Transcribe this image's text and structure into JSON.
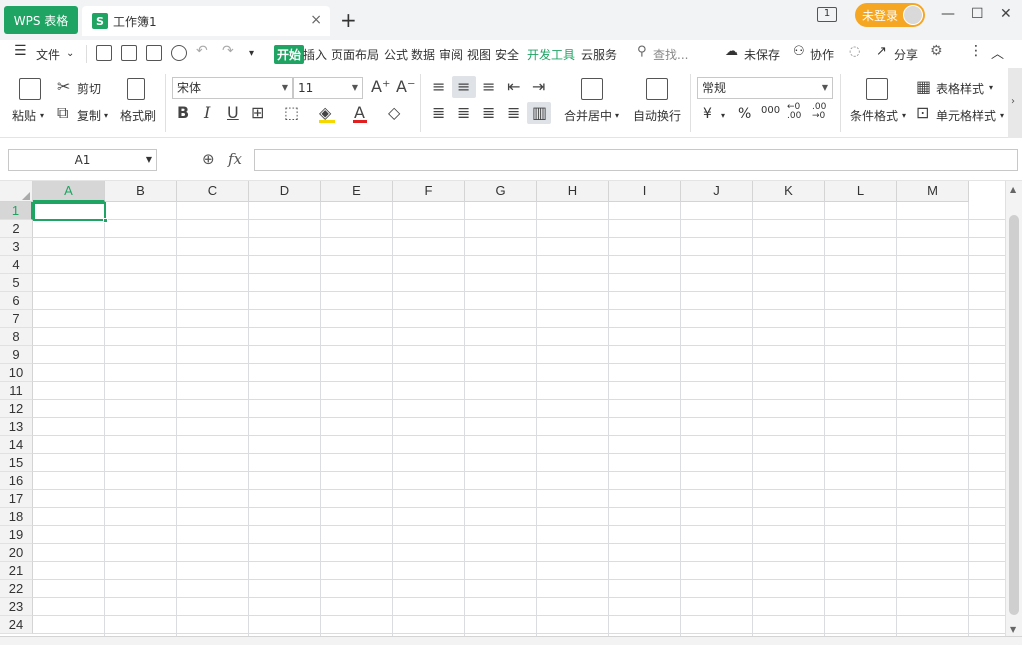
{
  "titlebar": {
    "app_tab": "WPS 表格",
    "doc_tab": "工作簿1",
    "doc_icon": "S",
    "close": "×",
    "add": "+",
    "login": "未登录",
    "badge": "1",
    "minimize": "—",
    "maximize": "☐",
    "close_window": "✕"
  },
  "menu": {
    "file": "文件",
    "tabs": [
      "开始",
      "插入",
      "页面布局",
      "公式",
      "数据",
      "审阅",
      "视图",
      "安全",
      "开发工具",
      "云服务"
    ],
    "search": "查找...",
    "unsaved": "未保存",
    "collab": "协作",
    "share": "分享"
  },
  "ribbon": {
    "paste": "粘贴",
    "cut": "剪切",
    "copy": "复制",
    "format_painter": "格式刷",
    "font_name": "宋体",
    "font_size": "11",
    "merge_center": "合并居中",
    "wrap_text": "自动换行",
    "number_format": "常规",
    "currency": "¥",
    "percent": "%",
    "thousands": "000",
    "cond_format": "条件格式",
    "table_style": "表格样式",
    "cell_style": "单元格样式"
  },
  "formula_bar": {
    "cell_ref": "A1",
    "fx": "fx",
    "value": ""
  },
  "grid": {
    "columns": [
      "A",
      "B",
      "C",
      "D",
      "E",
      "F",
      "G",
      "H",
      "I",
      "J",
      "K",
      "L",
      "M"
    ],
    "rows": [
      "1",
      "2",
      "3",
      "4",
      "5",
      "6",
      "7",
      "8",
      "9",
      "10",
      "11",
      "12",
      "13",
      "14",
      "15",
      "16",
      "17",
      "18",
      "19",
      "20",
      "21",
      "22",
      "23",
      "24"
    ],
    "active_cell": "A1"
  },
  "colors": {
    "accent": "#1fa463",
    "login": "#f5a623"
  }
}
